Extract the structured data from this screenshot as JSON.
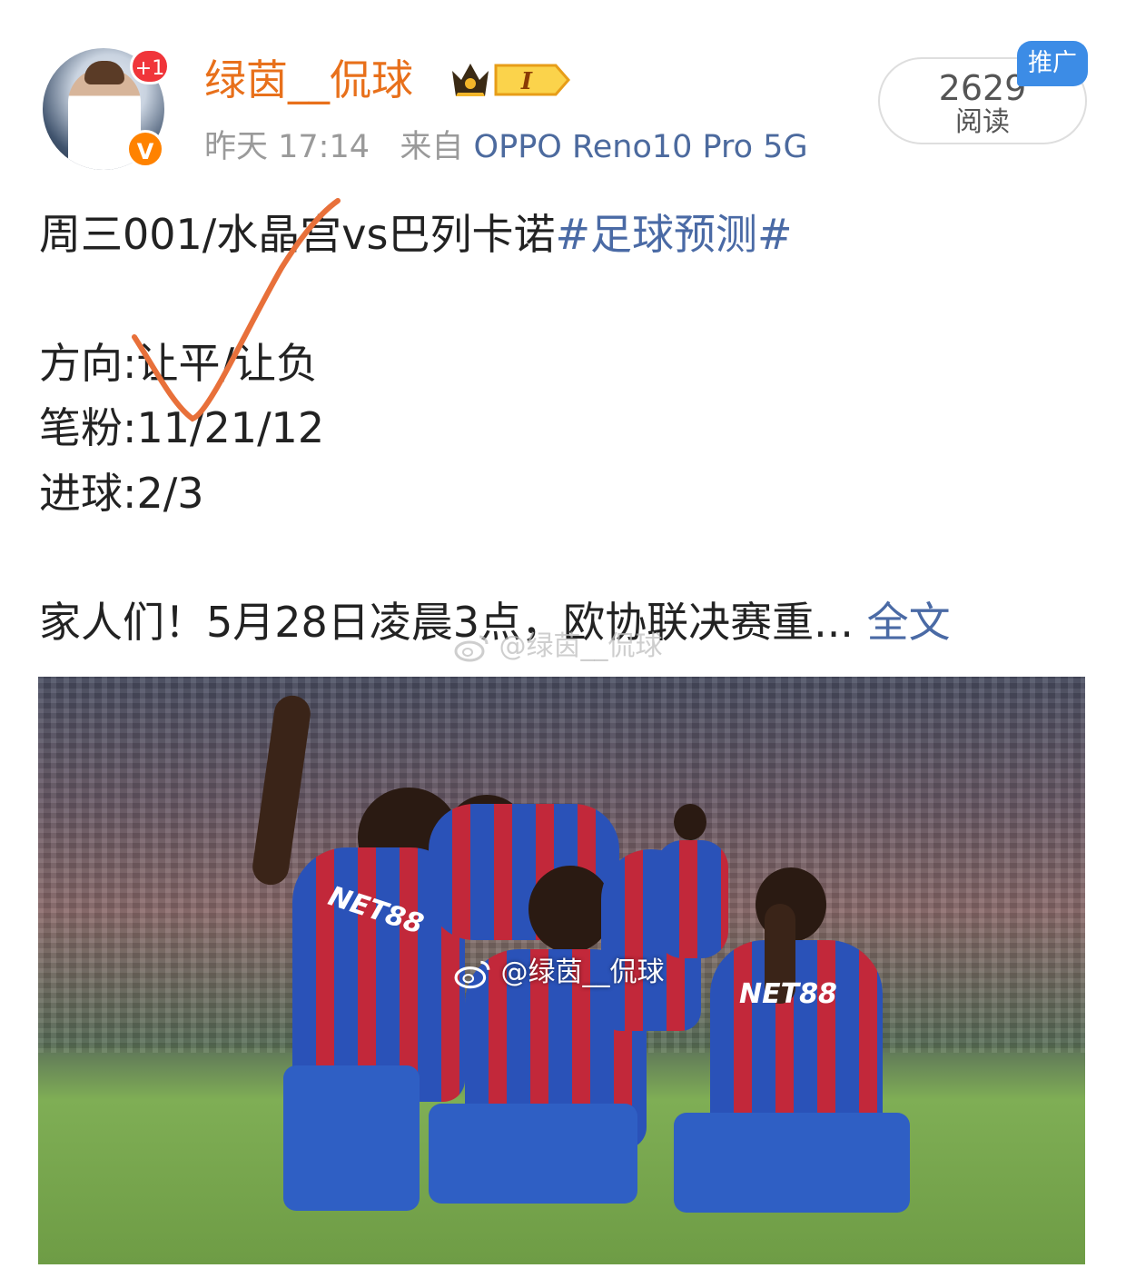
{
  "header": {
    "username": "绿茵__侃球",
    "notification_badge": "+1",
    "verified_badge": "V",
    "level_badge": "I",
    "time": "昨天 17:14",
    "source_prefix": "来自",
    "source_device": "OPPO Reno10 Pro 5G",
    "read_count": "2629",
    "read_label": "阅读",
    "promo_tag": "推广"
  },
  "post": {
    "line1_text": "周三001/水晶宫vs巴列卡诺",
    "line1_hashtag": "#足球预测#",
    "direction": "方向:让平/让负",
    "scores": "笔粉:11/21/12",
    "goals": "进球:2/3",
    "teaser": "家人们！5月28日凌晨3点，欧协联决赛重...",
    "fulltext_link": "全文",
    "watermark": "@绿茵__侃球"
  },
  "image": {
    "watermark": "@绿茵__侃球",
    "jersey_text": "NET88"
  },
  "colors": {
    "username": "#e8701b",
    "link": "#4a6aa5",
    "promo": "#3c8ce6",
    "check_mark": "#e8703a"
  }
}
